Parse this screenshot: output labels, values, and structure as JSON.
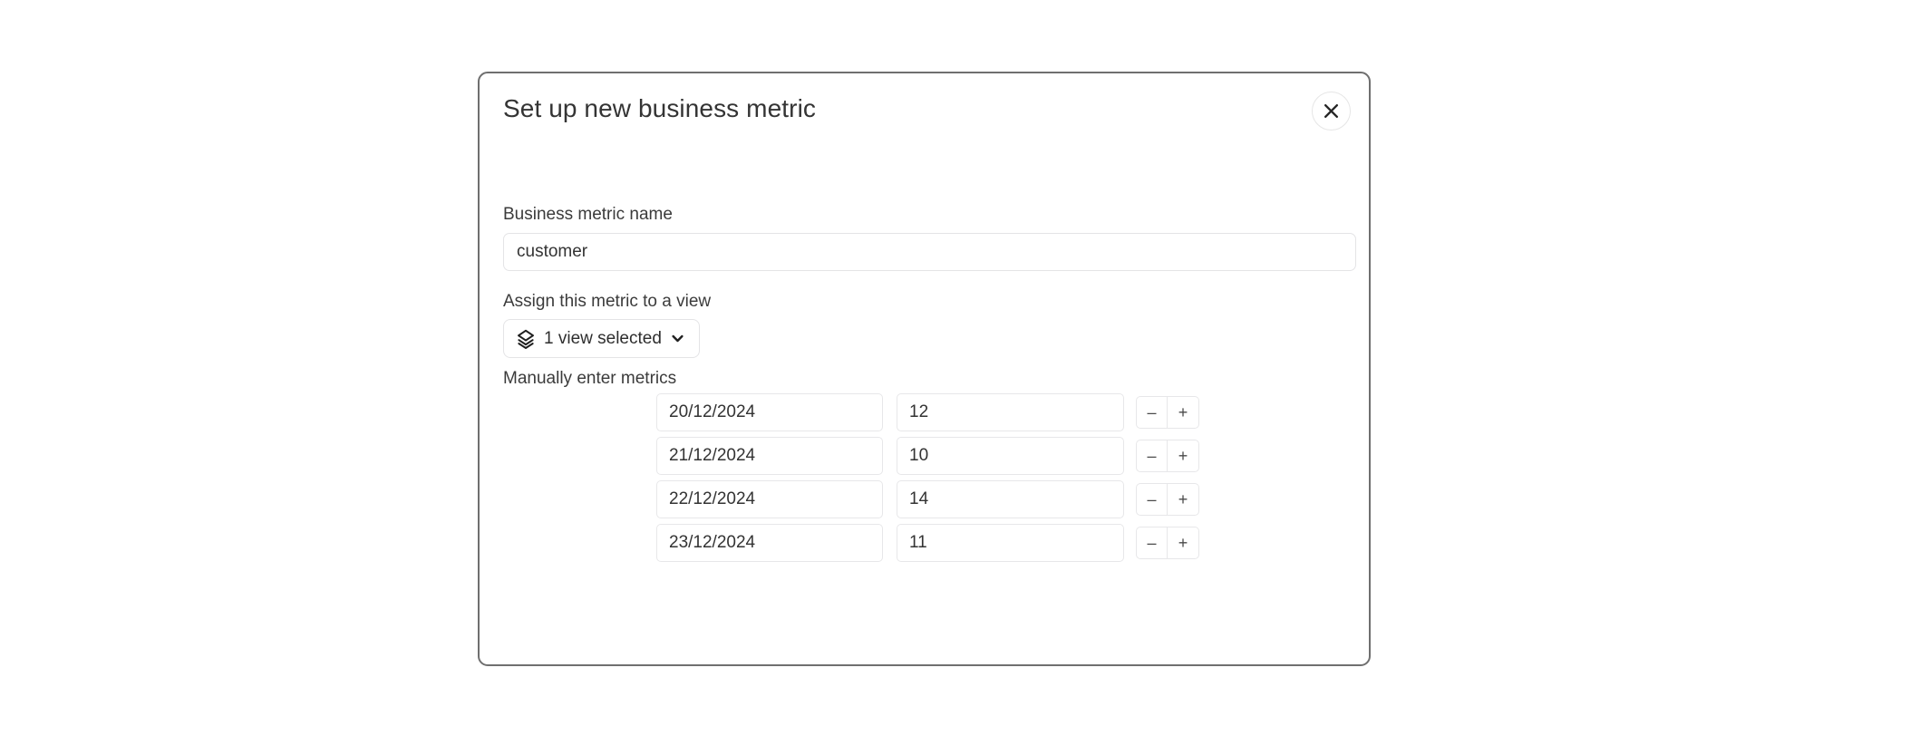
{
  "modal": {
    "title": "Set up new business metric",
    "close_label": "✕",
    "close_icon": "close-icon"
  },
  "form": {
    "name_field": {
      "label": "Business metric name",
      "value": "customer",
      "placeholder": "Business metric name"
    },
    "view_field": {
      "label": "Assign this metric to a view",
      "selected_text": "1 view selected",
      "leading_icon": "layers-icon",
      "trailing_icon": "chevron-down-icon"
    },
    "metrics_section": {
      "label": "Manually enter metrics",
      "date_placeholder": "DD/MM/YYYY",
      "value_placeholder": "0",
      "decrement_label": "–",
      "increment_label": "+",
      "rows": [
        {
          "date": "20/12/2024",
          "value": "12"
        },
        {
          "date": "21/12/2024",
          "value": "10"
        },
        {
          "date": "22/12/2024",
          "value": "14"
        },
        {
          "date": "23/12/2024",
          "value": "11"
        }
      ]
    }
  },
  "colors": {
    "page_background": "#ffffff",
    "modal_border": "#6f6f6f",
    "input_border": "#e4e4e6",
    "title_text": "#343434",
    "label_text": "#3b3b3b",
    "value_text": "#333333"
  }
}
